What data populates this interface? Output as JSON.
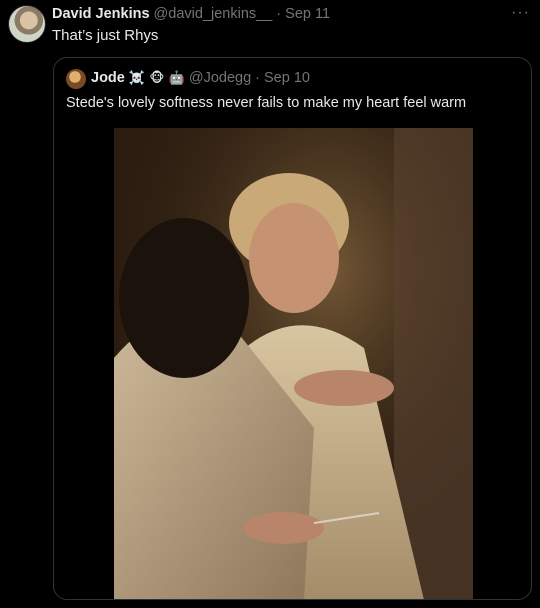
{
  "tweet": {
    "author_name": "David Jenkins",
    "author_handle": "@david_jenkins__",
    "separator": "·",
    "date": "Sep 11",
    "text": "That’s just Rhys",
    "more_label": "···"
  },
  "quote": {
    "author_name": "Jode",
    "emojis": [
      "☠️",
      "🐵",
      "🤖"
    ],
    "author_handle": "@Jodegg",
    "separator": "·",
    "date": "Sep 10",
    "text": "Stede's lovely softness never fails to make my heart feel warm"
  }
}
